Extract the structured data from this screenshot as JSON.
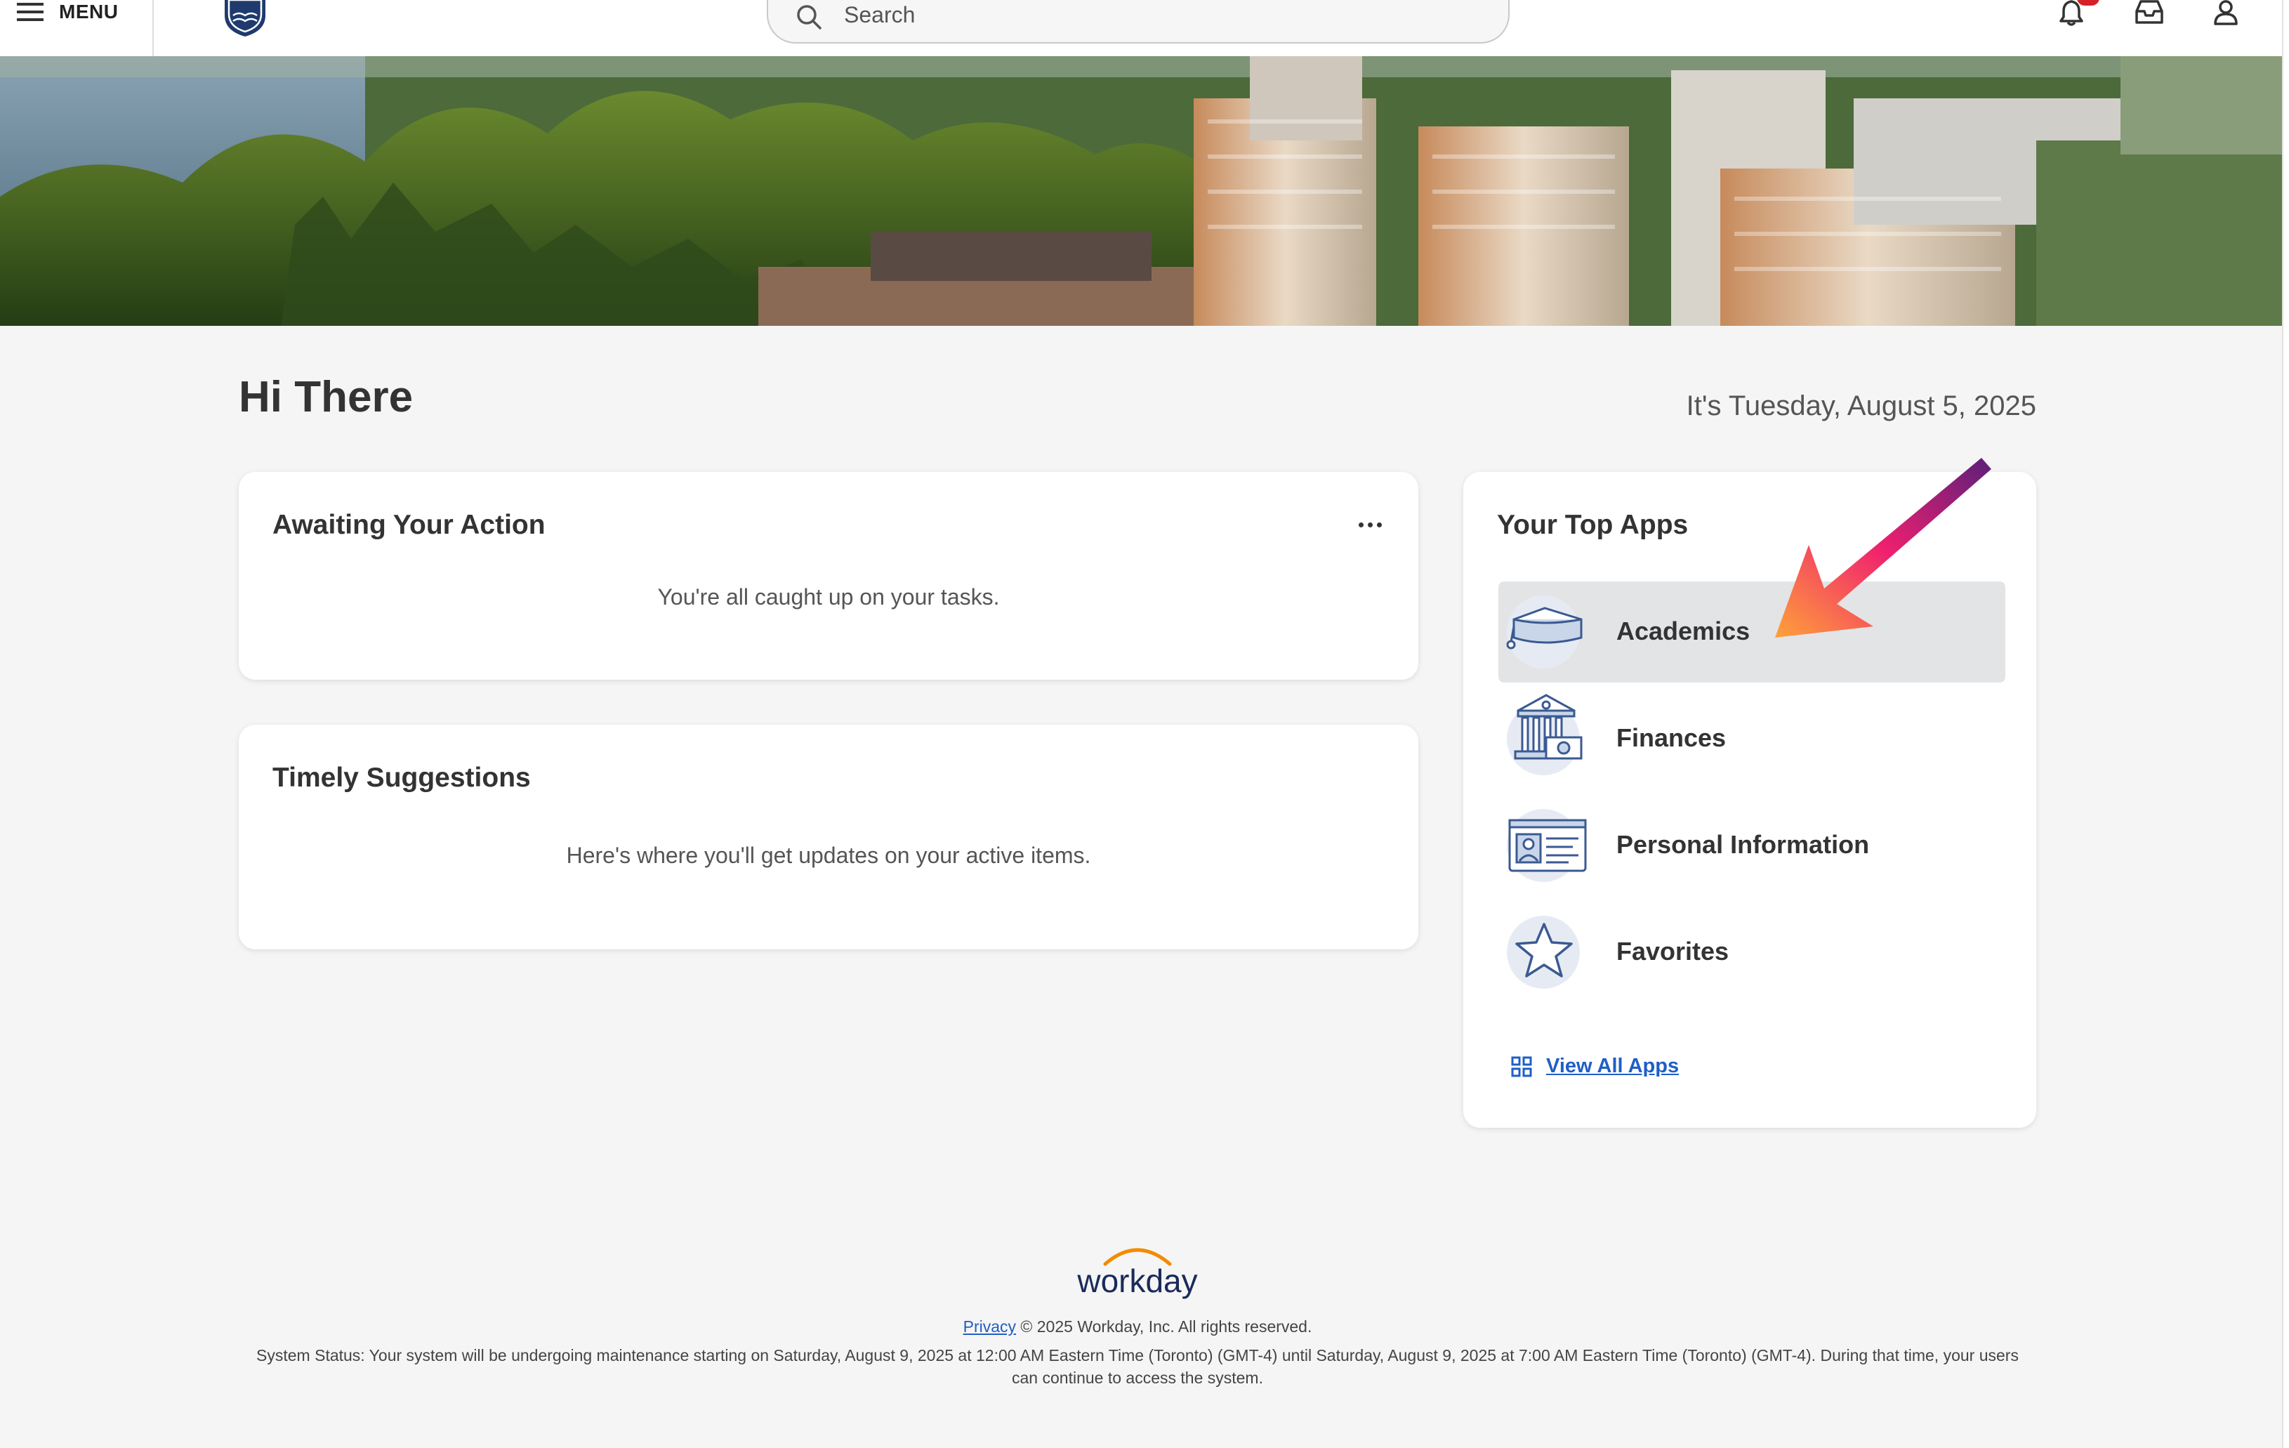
{
  "header": {
    "menu_label": "MENU",
    "search_placeholder": "Search"
  },
  "greeting": {
    "title": "Hi There",
    "date": "It's Tuesday, August 5, 2025"
  },
  "awaiting": {
    "title": "Awaiting Your Action",
    "message": "You're all caught up on your tasks."
  },
  "suggestions": {
    "title": "Timely Suggestions",
    "message": "Here's where you'll get updates on your active items."
  },
  "top_apps": {
    "title": "Your Top Apps",
    "items": [
      {
        "label": "Academics",
        "icon": "graduation-cap-icon"
      },
      {
        "label": "Finances",
        "icon": "bank-icon"
      },
      {
        "label": "Personal Information",
        "icon": "id-card-icon"
      },
      {
        "label": "Favorites",
        "icon": "star-icon"
      }
    ],
    "view_all": "View All Apps"
  },
  "footer": {
    "brand": "workday",
    "privacy": "Privacy",
    "copyright": "© 2025 Workday, Inc. All rights reserved.",
    "status": "System Status: Your system will be undergoing maintenance starting on Saturday, August 9, 2025 at 12:00 AM Eastern Time (Toronto) (GMT-4) until Saturday, August 9, 2025 at 7:00 AM Eastern Time (Toronto) (GMT-4). During that time, your users can continue to access the system."
  },
  "colors": {
    "accent_link": "#1f5fc6",
    "notification": "#d6202a",
    "selected_app_bg": "#e3e4e6",
    "icon_blue": "#3b5a92"
  }
}
